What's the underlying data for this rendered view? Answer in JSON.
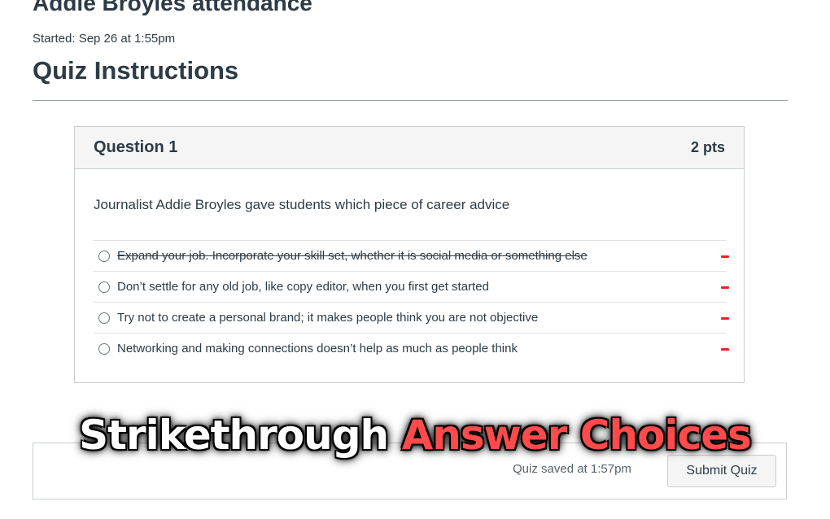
{
  "quiz": {
    "title": "Addie Broyles attendance",
    "started": "Started: Sep 26 at 1:55pm",
    "instructions_heading": "Quiz Instructions"
  },
  "question": {
    "name": "Question 1",
    "points": "2 pts",
    "text": "Journalist Addie Broyles gave students which piece of career advice",
    "answers": [
      {
        "label": "Expand your job. Incorporate your skill set, whether it is social media or something else",
        "struck": true
      },
      {
        "label": "Don’t settle for any old job, like copy editor, when you first get started",
        "struck": false
      },
      {
        "label": "Try not to create a personal brand; it makes people think you are not objective",
        "struck": false
      },
      {
        "label": "Networking and making connections doesn’t help as much as people think",
        "struck": false
      }
    ]
  },
  "footer": {
    "saved_text": "Quiz saved at 1:57pm",
    "submit_label": "Submit Quiz"
  },
  "caption": {
    "part1": "Strikethrough",
    "part2": "Answer Choices"
  },
  "colors": {
    "strike_toggle": "#e0262b",
    "caption_highlight": "#ff4b4b",
    "text": "#2d3b45"
  },
  "icons": {
    "radio": "radio-button",
    "strike_toggle": "minus-icon"
  }
}
